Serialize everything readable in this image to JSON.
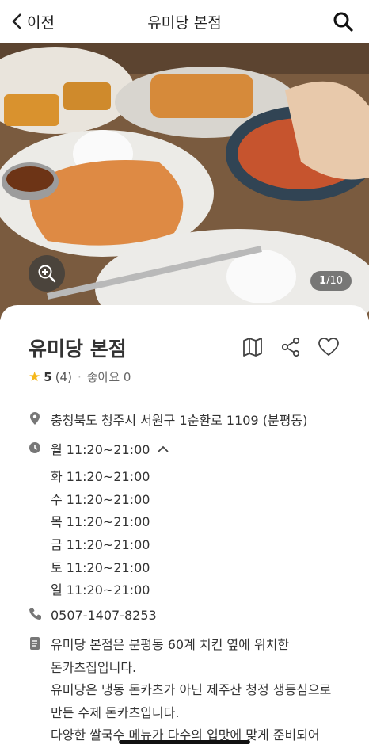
{
  "header": {
    "back_label": "이전",
    "title": "유미당 본점"
  },
  "gallery": {
    "current": "1",
    "total": "/10"
  },
  "place": {
    "name": "유미당 본점",
    "rating": "5",
    "review_count": "(4)",
    "likes": "좋아요 0",
    "address": "충청북도 청주시 서원구 1순환로 1109 (분평동)",
    "hours_today": "월 11:20~21:00",
    "hours": [
      "화 11:20~21:00",
      "수 11:20~21:00",
      "목 11:20~21:00",
      "금 11:20~21:00",
      "토 11:20~21:00",
      "일 11:20~21:00"
    ],
    "phone": "0507-1407-8253",
    "description_lines": [
      "유미당 본점은 분평동 60계 치킨 옆에 위치한",
      "돈카츠집입니다.",
      "유미당은 냉동 돈카츠가 아닌 제주산 청정 생등심으로",
      "만든 수제 돈카츠입니다.",
      "다양한 쌀국수 메뉴가 다수의 입맛에 맞게 준비되어"
    ]
  },
  "colors": {
    "accent_star": "#f5b71a",
    "icon_gray": "#777777"
  },
  "icons": [
    "back-chevron-icon",
    "search-icon",
    "zoom-in-icon",
    "map-icon",
    "share-icon",
    "heart-icon",
    "location-pin-icon",
    "clock-icon",
    "phone-icon",
    "document-icon",
    "chevron-up-icon"
  ]
}
